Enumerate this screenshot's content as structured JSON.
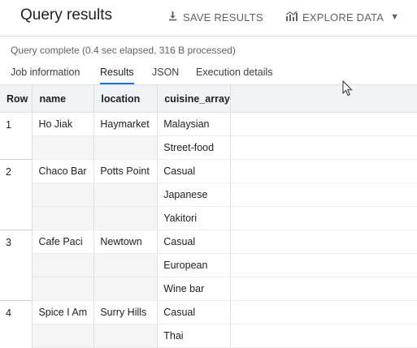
{
  "header": {
    "title": "Query results",
    "save_label": "SAVE RESULTS",
    "explore_label": "EXPLORE DATA",
    "save_icon": "download-icon",
    "explore_icon": "chart-icon",
    "accent_color": "#1a73e8"
  },
  "status": "Query complete (0.4 sec elapsed, 316 B processed)",
  "tabs": [
    {
      "label": "Job information"
    },
    {
      "label": "Results"
    },
    {
      "label": "JSON"
    },
    {
      "label": "Execution details"
    }
  ],
  "active_tab": "Results",
  "table": {
    "columns": [
      "Row",
      "name",
      "location",
      "cuisine_array"
    ],
    "rows": [
      {
        "row": "1",
        "name": "Ho Jiak",
        "location": "Haymarket",
        "cuisines": [
          "Malaysian",
          "Street-food"
        ]
      },
      {
        "row": "2",
        "name": "Chaco Bar",
        "location": "Potts Point",
        "cuisines": [
          "Casual",
          "Japanese",
          "Yakitori"
        ]
      },
      {
        "row": "3",
        "name": "Cafe Paci",
        "location": "Newtown",
        "cuisines": [
          "Casual",
          "European",
          "Wine bar"
        ]
      },
      {
        "row": "4",
        "name": "Spice I Am",
        "location": "Surry Hills",
        "cuisines": [
          "Casual",
          "Thai"
        ]
      }
    ]
  }
}
